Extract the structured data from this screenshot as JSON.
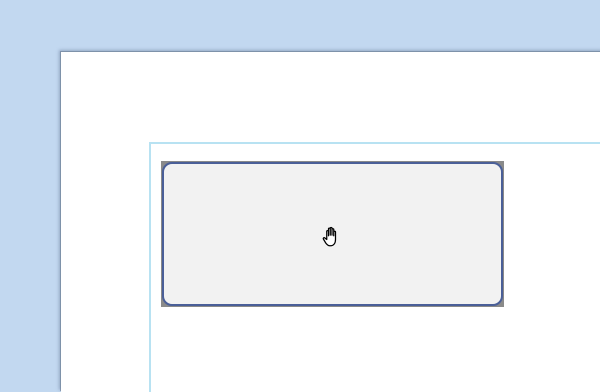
{
  "window": {
    "background_color": "#c2d8f0"
  },
  "sheet": {
    "background_color": "#ffffff"
  },
  "panel": {
    "border_color": "#b8e2f2"
  },
  "button": {
    "label": "",
    "background_color": "#f2f2f2",
    "border_color": "#4a5f98",
    "cursor_icon": "hand-grab-icon"
  }
}
